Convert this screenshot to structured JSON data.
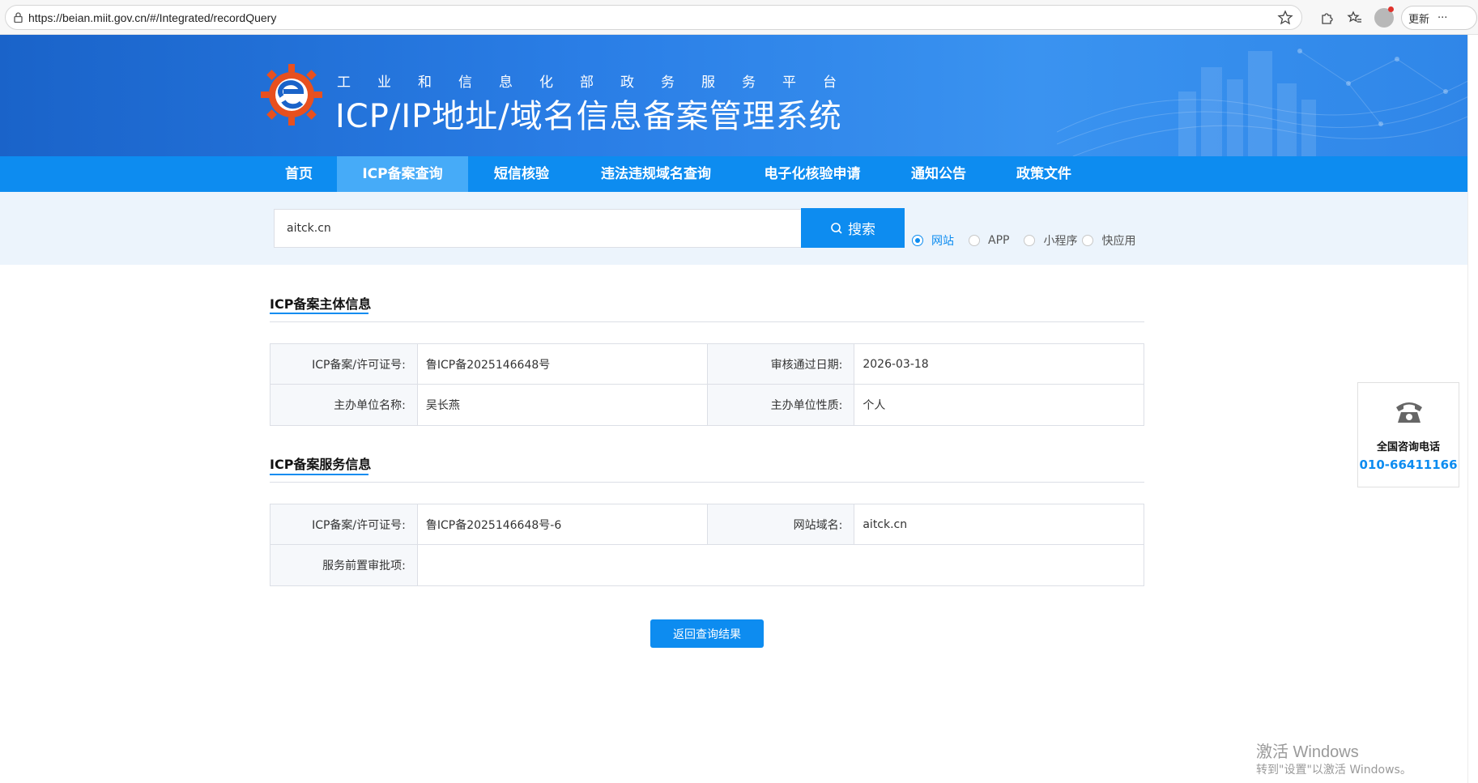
{
  "browser": {
    "url": "https://beian.miit.gov.cn/#/Integrated/recordQuery",
    "update_label": "更新",
    "more_label": "···"
  },
  "header": {
    "subtitle": "工业和信息化部政务服务平台",
    "title": "ICP/IP地址/域名信息备案管理系统"
  },
  "nav": {
    "items": [
      {
        "label": "首页"
      },
      {
        "label": "ICP备案查询"
      },
      {
        "label": "短信核验"
      },
      {
        "label": "违法违规域名查询"
      },
      {
        "label": "电子化核验申请"
      },
      {
        "label": "通知公告"
      },
      {
        "label": "政策文件"
      }
    ],
    "active": "ICP备案查询"
  },
  "search": {
    "value": "aitck.cn",
    "button_label": "搜索",
    "options": [
      {
        "label": "网站",
        "checked": true
      },
      {
        "label": "APP",
        "checked": false
      },
      {
        "label": "小程序",
        "checked": false
      },
      {
        "label": "快应用",
        "checked": false
      }
    ]
  },
  "subject_info": {
    "title": "ICP备案主体信息",
    "license_label": "ICP备案/许可证号:",
    "license_value": "鲁ICP备2025146648号",
    "date_label": "审核通过日期:",
    "date_value": "2026-03-18",
    "org_label": "主办单位名称:",
    "org_value": "吴长燕",
    "nature_label": "主办单位性质:",
    "nature_value": "个人"
  },
  "service_info": {
    "title": "ICP备案服务信息",
    "license_label": "ICP备案/许可证号:",
    "license_value": "鲁ICP备2025146648号-6",
    "domain_label": "网站域名:",
    "domain_value": "aitck.cn",
    "approval_label": "服务前置审批项:",
    "approval_value": ""
  },
  "back_button": "返回查询结果",
  "hotline": {
    "label": "全国咨询电话",
    "number": "010-66411166"
  },
  "watermark": {
    "title": "激活 Windows",
    "subtitle": "转到\"设置\"以激活 Windows。"
  },
  "colors": {
    "primary": "#0d8cf0",
    "nav_active": "#46abf8",
    "banner": "#2a7ee6",
    "search_band": "#ecf4fc"
  }
}
